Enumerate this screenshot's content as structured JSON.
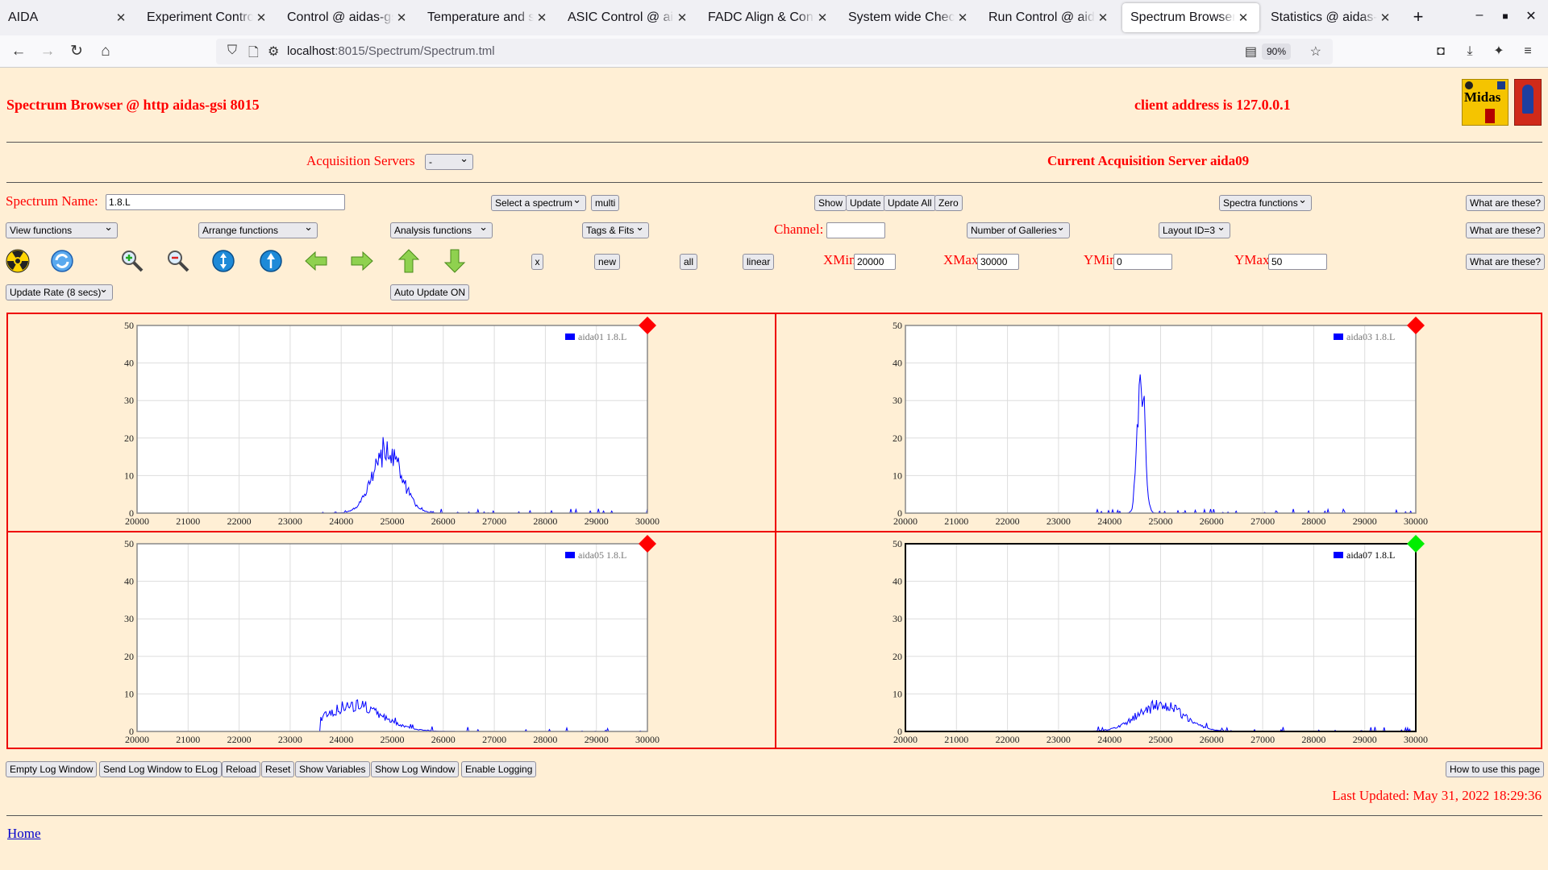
{
  "browser": {
    "tabs": [
      {
        "label": "AIDA",
        "active": false
      },
      {
        "label": "Experiment Control @",
        "active": false
      },
      {
        "label": "Control @ aidas-gsi",
        "active": false
      },
      {
        "label": "Temperature and stat",
        "active": false
      },
      {
        "label": "ASIC Control @ aidas",
        "active": false
      },
      {
        "label": "FADC Align & Control",
        "active": false
      },
      {
        "label": "System wide Checks @",
        "active": false
      },
      {
        "label": "Run Control @ aidas-",
        "active": false
      },
      {
        "label": "Spectrum Browser @",
        "active": true
      },
      {
        "label": "Statistics @ aidas-gsi",
        "active": false
      }
    ],
    "url_host": "localhost",
    "url_path": ":8015/Spectrum/Spectrum.tml",
    "zoom": "90%"
  },
  "header": {
    "title": "Spectrum Browser @ http aidas-gsi 8015",
    "client": "client address is 127.0.0.1"
  },
  "acq": {
    "label": "Acquisition Servers",
    "select_value": "-",
    "current": "Current Acquisition Server aida09"
  },
  "controls": {
    "spectrum_name_label": "Spectrum Name:",
    "spectrum_name_value": "1.8.L",
    "select_spectrum": "Select a spectrum",
    "multi": "multi",
    "show": "Show",
    "update": "Update",
    "update_all": "Update All",
    "zero": "Zero",
    "spectra_functions": "Spectra functions",
    "what_are_these": "What are these?",
    "view_functions": "View functions",
    "arrange_functions": "Arrange functions",
    "analysis_functions": "Analysis functions",
    "tags_fits": "Tags & Fits",
    "channel_label": "Channel:",
    "channel_value": "",
    "number_of_galleries": "Number of Galleries",
    "layout": "Layout ID=3",
    "x_btn": "x",
    "new_btn": "new",
    "all_btn": "all",
    "linear_btn": "linear",
    "xmin_label": "XMin",
    "xmin_value": "20000",
    "xmax_label": "XMax",
    "xmax_value": "30000",
    "ymin_label": "YMin",
    "ymin_value": "0",
    "ymax_label": "YMax",
    "ymax_value": "50",
    "update_rate": "Update Rate (8 secs)",
    "auto_update": "Auto Update ON"
  },
  "toolbar_icons": [
    "radiation-icon",
    "refresh-icon",
    "zoom-in-icon",
    "zoom-out-icon",
    "expand-y-icon",
    "expand-x-icon",
    "arrow-left-icon",
    "arrow-right-icon",
    "arrow-up-icon",
    "arrow-down-icon"
  ],
  "chart_data": [
    {
      "type": "line",
      "legend": "aida01 1.8.L",
      "xlim": [
        20000,
        30000
      ],
      "ylim": [
        0,
        50
      ],
      "xticks": [
        "20000",
        "21000",
        "22000",
        "23000",
        "24000",
        "25000",
        "26000",
        "27000",
        "28000",
        "29000",
        "30000"
      ],
      "yticks": [
        "0",
        "10",
        "20",
        "30",
        "40",
        "50"
      ],
      "peak_center": 24900,
      "peak_height": 17,
      "peak_width": 280,
      "status_color": "#ff0000",
      "selected": false
    },
    {
      "type": "line",
      "legend": "aida03 1.8.L",
      "xlim": [
        20000,
        30000
      ],
      "ylim": [
        0,
        50
      ],
      "xticks": [
        "20000",
        "21000",
        "22000",
        "23000",
        "24000",
        "25000",
        "26000",
        "27000",
        "28000",
        "29000",
        "30000"
      ],
      "yticks": [
        "0",
        "10",
        "20",
        "30",
        "40",
        "50"
      ],
      "peak_center": 24620,
      "peak_height": 38,
      "peak_width": 70,
      "status_color": "#ff0000",
      "selected": false
    },
    {
      "type": "line",
      "legend": "aida05 1.8.L",
      "xlim": [
        20000,
        30000
      ],
      "ylim": [
        0,
        50
      ],
      "xticks": [
        "20000",
        "21000",
        "22000",
        "23000",
        "24000",
        "25000",
        "26000",
        "27000",
        "28000",
        "29000",
        "30000"
      ],
      "yticks": [
        "0",
        "10",
        "20",
        "30",
        "40",
        "50"
      ],
      "peak_center": 24250,
      "peak_height": 7,
      "peak_width": 550,
      "status_color": "#ff0000",
      "selected": false
    },
    {
      "type": "line",
      "legend": "aida07 1.8.L",
      "xlim": [
        20000,
        30000
      ],
      "ylim": [
        0,
        50
      ],
      "xticks": [
        "20000",
        "21000",
        "22000",
        "23000",
        "24000",
        "25000",
        "26000",
        "27000",
        "28000",
        "29000",
        "30000"
      ],
      "yticks": [
        "0",
        "10",
        "20",
        "30",
        "40",
        "50"
      ],
      "peak_center": 25000,
      "peak_height": 7,
      "peak_width": 450,
      "status_color": "#00ee00",
      "selected": true
    }
  ],
  "bottom": {
    "empty_log": "Empty Log Window",
    "send_log": "Send Log Window to ELog",
    "reload": "Reload",
    "reset": "Reset",
    "show_variables": "Show Variables",
    "show_log": "Show Log Window",
    "enable_logging": "Enable Logging",
    "how_to": "How to use this page",
    "last_updated": "Last Updated: May 31, 2022 18:29:36",
    "home": "Home"
  }
}
